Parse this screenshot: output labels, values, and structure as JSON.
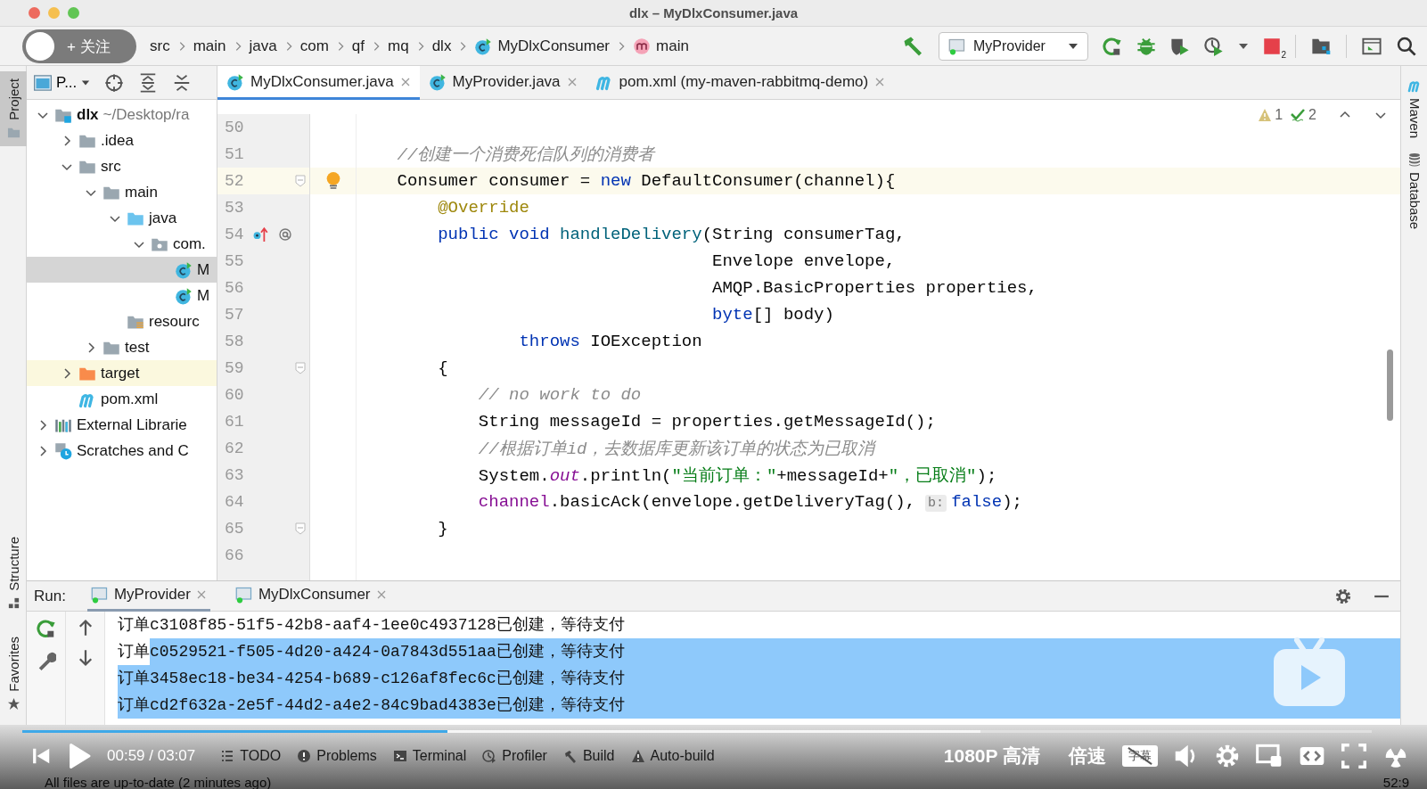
{
  "window": {
    "title": "dlx – MyDlxConsumer.java"
  },
  "follow_button": {
    "label": "+ 关注"
  },
  "breadcrumbs": [
    {
      "label": "src",
      "kind": "plain"
    },
    {
      "label": "main",
      "kind": "plain"
    },
    {
      "label": "java",
      "kind": "plain"
    },
    {
      "label": "com",
      "kind": "plain"
    },
    {
      "label": "qf",
      "kind": "plain"
    },
    {
      "label": "mq",
      "kind": "plain"
    },
    {
      "label": "dlx",
      "kind": "plain"
    },
    {
      "label": "MyDlxConsumer",
      "kind": "class"
    },
    {
      "label": "main",
      "kind": "method"
    }
  ],
  "toolbar": {
    "run_config": "MyProvider",
    "stop_badge": "2"
  },
  "left_stripe": [
    {
      "label": "Project",
      "kind": "folder",
      "selected": true
    },
    {
      "label": "Structure",
      "kind": "structure",
      "selected": false
    },
    {
      "label": "Favorites",
      "kind": "star",
      "selected": false
    }
  ],
  "project_panel": {
    "view": "P...",
    "tree": [
      {
        "label": "dlx",
        "detail": "~/Desktop/ra",
        "kind": "module",
        "expanded": true,
        "selected": false,
        "children": [
          {
            "label": ".idea",
            "kind": "folder",
            "expanded": false,
            "selected": false
          },
          {
            "label": "src",
            "kind": "folder",
            "expanded": true,
            "selected": false,
            "children": [
              {
                "label": "main",
                "kind": "folder",
                "expanded": true,
                "selected": false,
                "children": [
                  {
                    "label": "java",
                    "kind": "source",
                    "expanded": true,
                    "selected": false,
                    "children": [
                      {
                        "label": "com.",
                        "kind": "package",
                        "expanded": true,
                        "selected": false,
                        "children": [
                          {
                            "label": "M",
                            "kind": "class",
                            "selected": true
                          },
                          {
                            "label": "M",
                            "kind": "class",
                            "selected": false
                          }
                        ]
                      }
                    ]
                  },
                  {
                    "label": "resourc",
                    "kind": "resources",
                    "selected": false
                  }
                ]
              },
              {
                "label": "test",
                "kind": "folder",
                "expanded": false,
                "selected": false
              }
            ]
          },
          {
            "label": "target",
            "kind": "excluded",
            "expanded": false,
            "selected": false
          },
          {
            "label": "pom.xml",
            "kind": "maven",
            "selected": false
          }
        ]
      },
      {
        "label": "External Librarie",
        "kind": "libraries",
        "expanded": false,
        "selected": false
      },
      {
        "label": "Scratches and C",
        "kind": "scratches",
        "expanded": false,
        "selected": false
      }
    ]
  },
  "editor": {
    "tabs": [
      {
        "label": "MyDlxConsumer.java",
        "kind": "class",
        "selected": true
      },
      {
        "label": "MyProvider.java",
        "kind": "class",
        "selected": false
      },
      {
        "label": "pom.xml (my-maven-rabbitmq-demo)",
        "kind": "maven",
        "selected": false
      }
    ],
    "inspections": {
      "warnings": "1",
      "checks": "2"
    },
    "lines": [
      {
        "number": "50",
        "current": false
      },
      {
        "number": "51",
        "current": false,
        "tokens": [
          {
            "kind": "comment",
            "text": "    //创建一个消费死信队列的消费者"
          }
        ]
      },
      {
        "number": "52",
        "current": true,
        "fold_marker": true,
        "bulb": true,
        "tokens": [
          {
            "kind": "plain",
            "text": "    Consumer consumer = "
          },
          {
            "kind": "keyword",
            "text": "new"
          },
          {
            "kind": "plain",
            "text": " DefaultConsumer(channel){"
          }
        ]
      },
      {
        "number": "53",
        "current": false,
        "tokens": [
          {
            "kind": "annotation",
            "text": "        @Override"
          }
        ]
      },
      {
        "number": "54",
        "current": false,
        "override_marker": true,
        "tokens": [
          {
            "kind": "keyword",
            "text": "        public void "
          },
          {
            "kind": "method",
            "text": "handleDelivery"
          },
          {
            "kind": "plain",
            "text": "(String consumerTag,"
          }
        ]
      },
      {
        "number": "55",
        "current": false,
        "tokens": [
          {
            "kind": "plain",
            "text": "                                   Envelope envelope,"
          }
        ]
      },
      {
        "number": "56",
        "current": false,
        "tokens": [
          {
            "kind": "plain",
            "text": "                                   AMQP.BasicProperties properties,"
          }
        ]
      },
      {
        "number": "57",
        "current": false,
        "tokens": [
          {
            "kind": "keyword",
            "text": "                                   byte"
          },
          {
            "kind": "plain",
            "text": "[] body)"
          }
        ]
      },
      {
        "number": "58",
        "current": false,
        "tokens": [
          {
            "kind": "keyword",
            "text": "                throws"
          },
          {
            "kind": "plain",
            "text": " IOException"
          }
        ]
      },
      {
        "number": "59",
        "current": false,
        "fold_marker": true,
        "tokens": [
          {
            "kind": "plain",
            "text": "        {"
          }
        ]
      },
      {
        "number": "60",
        "current": false,
        "tokens": [
          {
            "kind": "comment",
            "text": "            // no work to do"
          }
        ]
      },
      {
        "number": "61",
        "current": false,
        "tokens": [
          {
            "kind": "plain",
            "text": "            String messageId = properties.getMessageId();"
          }
        ]
      },
      {
        "number": "62",
        "current": false,
        "tokens": [
          {
            "kind": "comment",
            "text": "            //根据订单id，去数据库更新该订单的状态为已取消"
          }
        ]
      },
      {
        "number": "63",
        "current": false,
        "tokens": [
          {
            "kind": "plain",
            "text": "            System."
          },
          {
            "kind": "static",
            "text": "out"
          },
          {
            "kind": "plain",
            "text": ".println("
          },
          {
            "kind": "string",
            "text": "\"当前订单：\""
          },
          {
            "kind": "plain",
            "text": "+messageId+"
          },
          {
            "kind": "string",
            "text": "\"，已取消\""
          },
          {
            "kind": "plain",
            "text": ");"
          }
        ]
      },
      {
        "number": "64",
        "current": false,
        "tokens": [
          {
            "kind": "field",
            "text": "            channel"
          },
          {
            "kind": "plain",
            "text": ".basicAck(envelope.getDeliveryTag(),"
          },
          {
            "kind": "hint",
            "text": "b:"
          },
          {
            "kind": "keyword",
            "text": "false"
          },
          {
            "kind": "plain",
            "text": ");"
          }
        ]
      },
      {
        "number": "65",
        "current": false,
        "fold_marker": true,
        "tokens": [
          {
            "kind": "plain",
            "text": "        }"
          }
        ]
      },
      {
        "number": "66",
        "current": false
      }
    ]
  },
  "right_stripe": [
    {
      "label": "Maven",
      "kind": "maven"
    },
    {
      "label": "Database",
      "kind": "database"
    }
  ],
  "run_panel": {
    "label": "Run:",
    "tabs": [
      {
        "label": "MyProvider",
        "selected": true
      },
      {
        "label": "MyDlxConsumer",
        "selected": false
      }
    ],
    "console": [
      {
        "segments": [
          {
            "text": "订单c3108f85-51f5-42b8-aaf4-1ee0c4937128已创建，等待支付",
            "selected": false
          }
        ]
      },
      {
        "segments": [
          {
            "text": "订单",
            "selected": false
          },
          {
            "text": "c0529521-f505-4d20-a424-0a7843d551aa已创建，等待支付",
            "selected": true
          }
        ]
      },
      {
        "segments": [
          {
            "text": "订单3458ec18-be34-4254-b689-c126af8fec6c已创建，等待支付",
            "selected": true
          }
        ]
      },
      {
        "segments": [
          {
            "text": "订单cd2f632a-2e5f-44d2-a4e2-84c9bad4383e已创建，等待支付",
            "selected": true
          }
        ]
      }
    ]
  },
  "tool_windows": [
    {
      "label": "TODO",
      "kind": "todo"
    },
    {
      "label": "Problems",
      "kind": "problems"
    },
    {
      "label": "Terminal",
      "kind": "terminal"
    },
    {
      "label": "Profiler",
      "kind": "profiler"
    },
    {
      "label": "Build",
      "kind": "build"
    },
    {
      "label": "Auto-build",
      "kind": "warning"
    }
  ],
  "status_bar": {
    "message": "All files are up-to-date (2 minutes ago)",
    "position": "52:9"
  },
  "video": {
    "time": "00:59 / 03:07",
    "quality": "1080P 高清",
    "speed": "倍速",
    "subtitle": "字幕",
    "progress": {
      "level": 0.315,
      "buffer": {
        "level": 0.71
      }
    }
  }
}
